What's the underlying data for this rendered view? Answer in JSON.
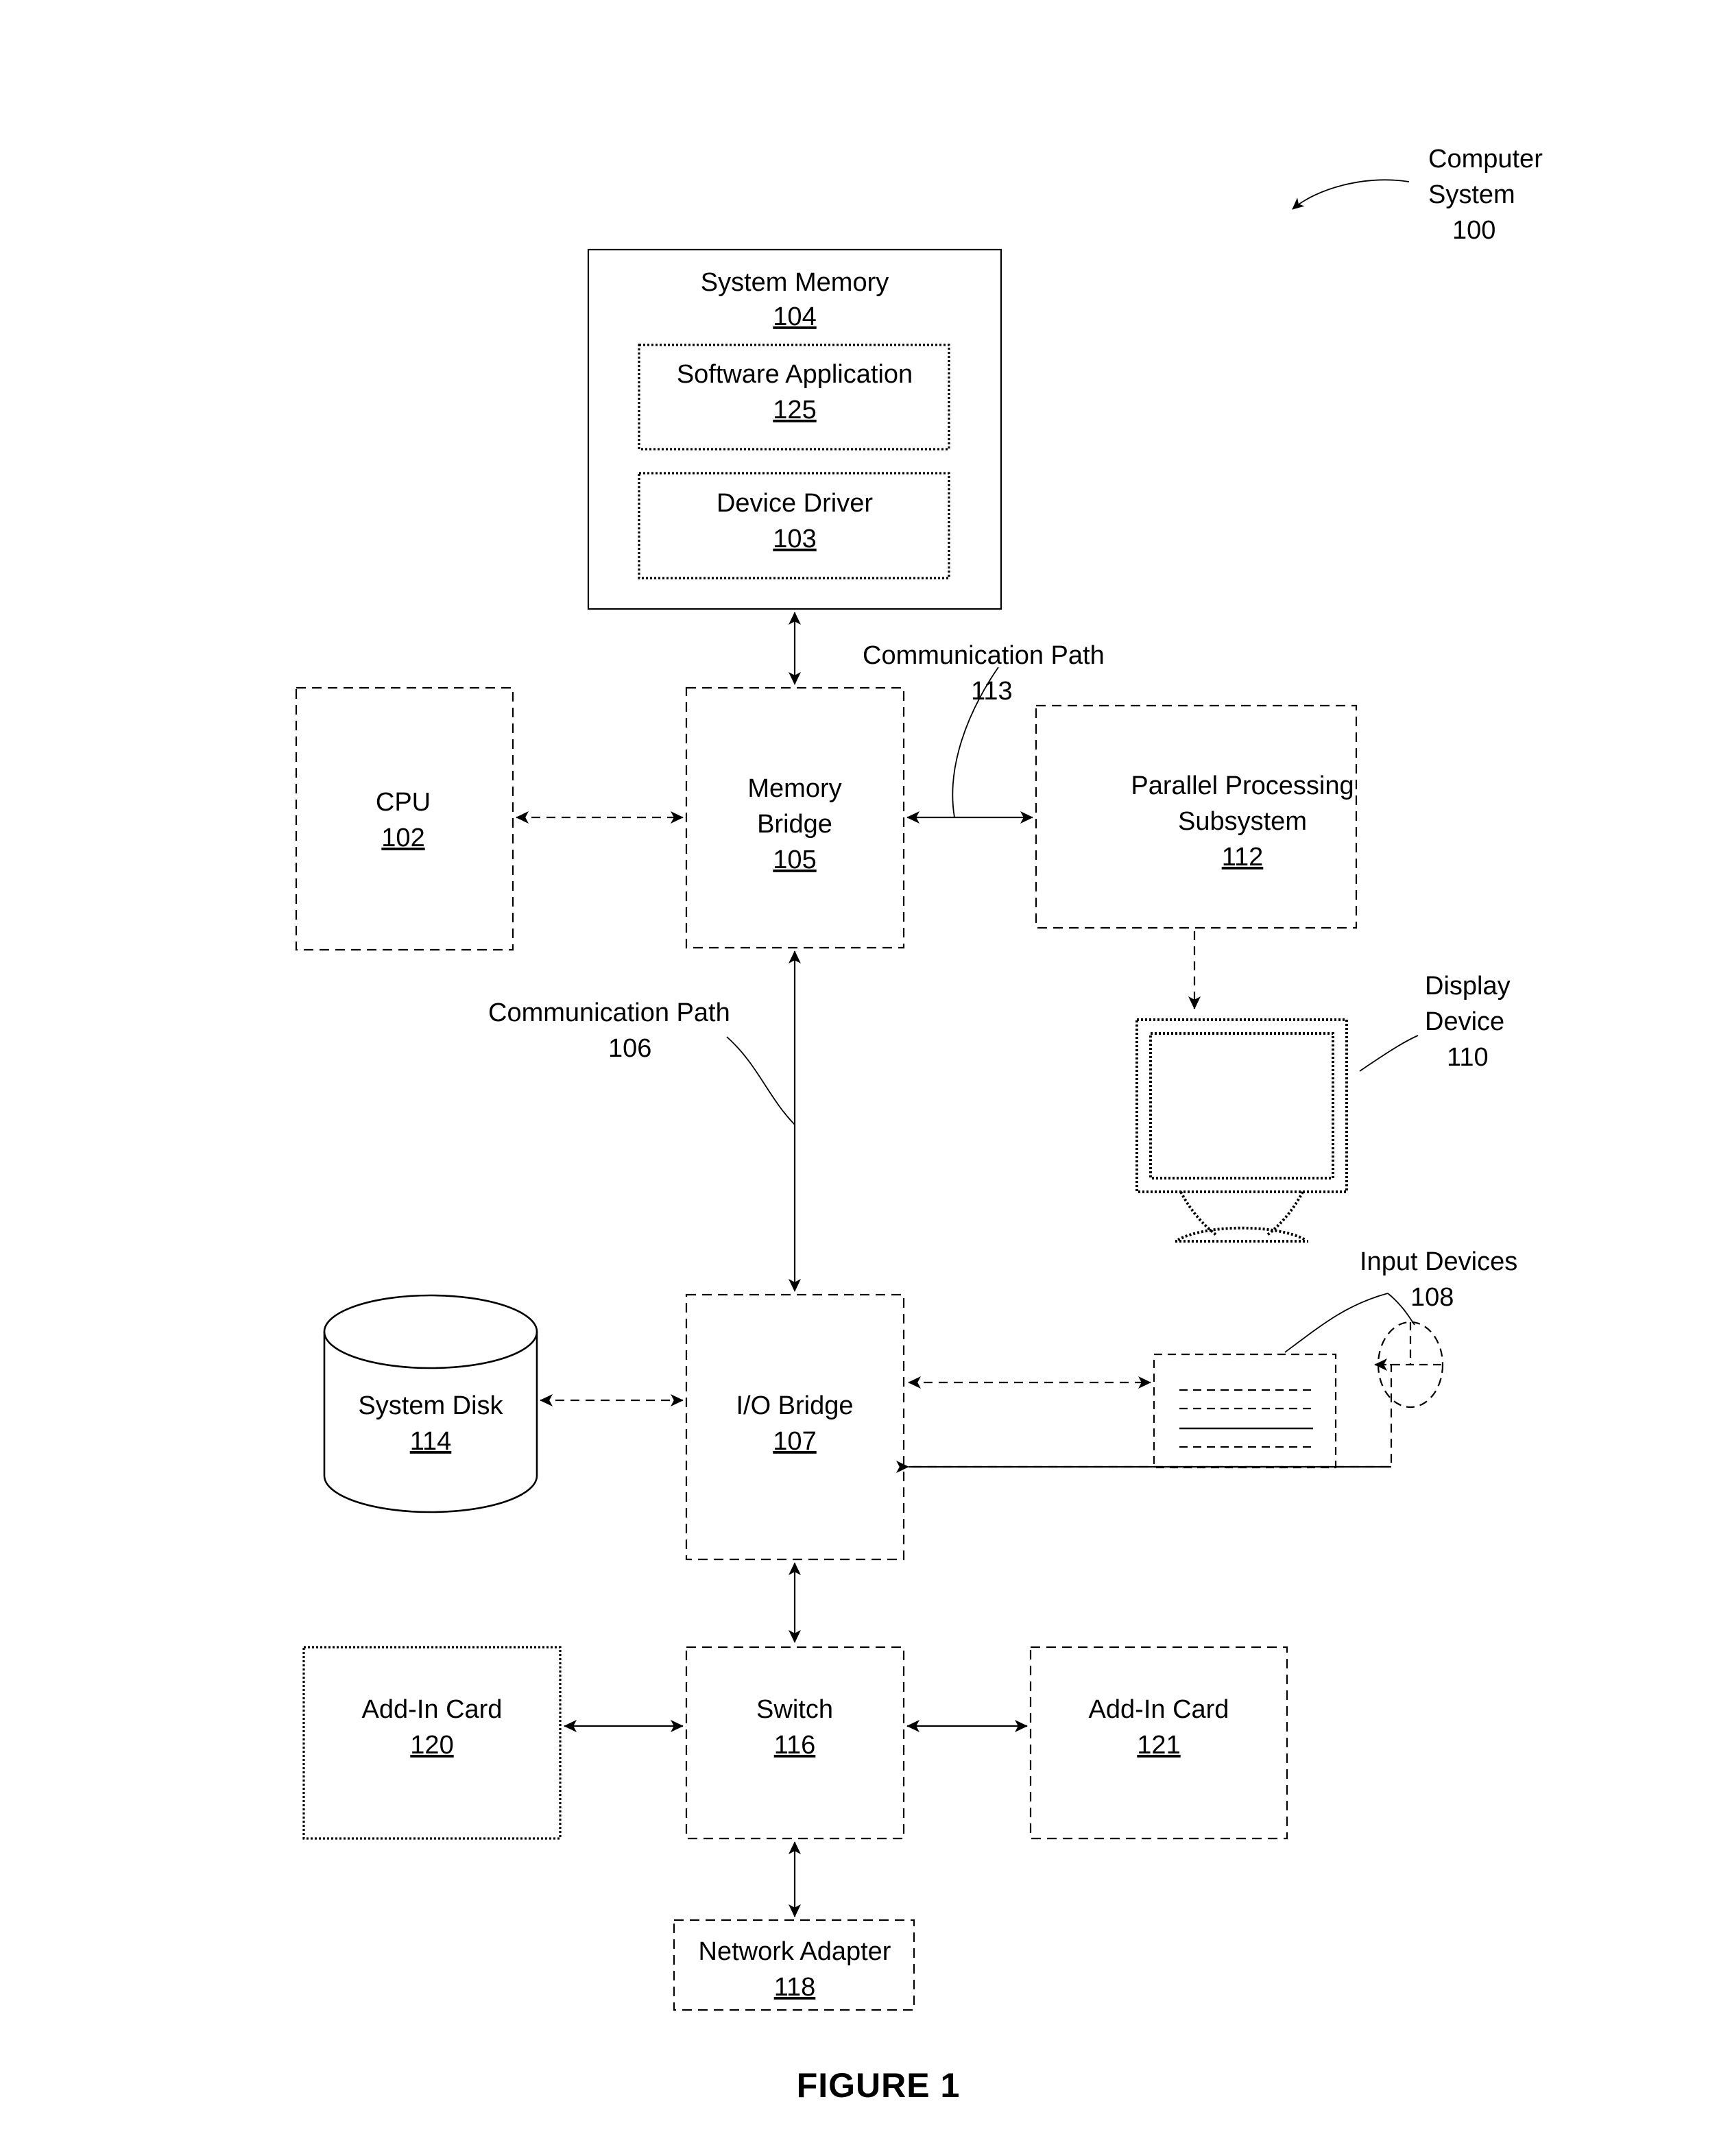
{
  "figure": {
    "caption": "FIGURE 1"
  },
  "callouts": {
    "computer_system": {
      "line1": "Computer",
      "line2": "System",
      "ref": "100"
    },
    "communication_path_113": {
      "line1": "Communication Path",
      "ref": "113"
    },
    "communication_path_106": {
      "line1": "Communication Path",
      "ref": "106"
    },
    "display_device": {
      "line1": "Display",
      "line2": "Device",
      "ref": "110"
    },
    "input_devices": {
      "line1": "Input Devices",
      "ref": "108"
    }
  },
  "blocks": {
    "system_memory": {
      "label": "System Memory",
      "ref": "104"
    },
    "software_application": {
      "label": "Software Application",
      "ref": "125"
    },
    "device_driver": {
      "label": "Device Driver",
      "ref": "103"
    },
    "cpu": {
      "label": "CPU",
      "ref": "102"
    },
    "memory_bridge": {
      "label_line1": "Memory",
      "label_line2": "Bridge",
      "ref": "105"
    },
    "parallel_processing_subsystem": {
      "label_line1": "Parallel Processing",
      "label_line2": "Subsystem",
      "ref": "112"
    },
    "system_disk": {
      "label": "System Disk",
      "ref": "114"
    },
    "io_bridge": {
      "label": "I/O Bridge",
      "ref": "107"
    },
    "add_in_card_120": {
      "label": "Add-In Card",
      "ref": "120"
    },
    "switch": {
      "label": "Switch",
      "ref": "116"
    },
    "add_in_card_121": {
      "label": "Add-In Card",
      "ref": "121"
    },
    "network_adapter": {
      "label": "Network Adapter",
      "ref": "118"
    }
  },
  "colors": {
    "ink": "#000000",
    "paper": "#ffffff"
  }
}
